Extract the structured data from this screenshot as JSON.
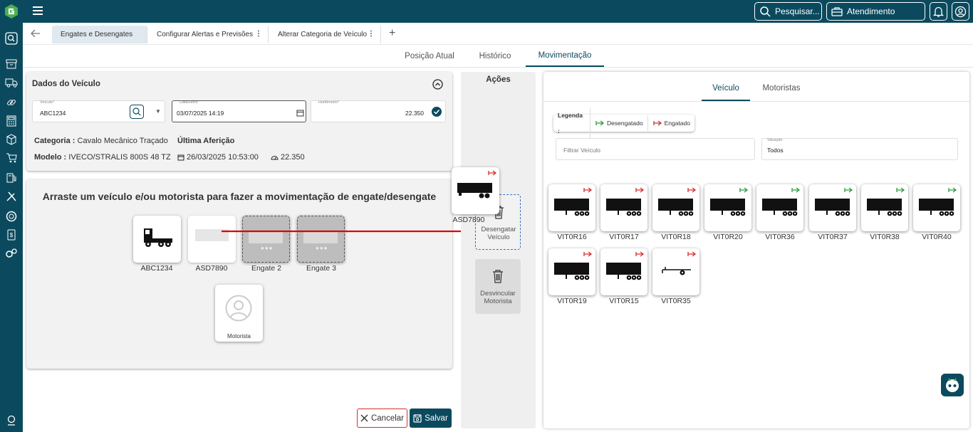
{
  "top": {
    "search_label": "Pesquisar...",
    "service_label": "Atendimento"
  },
  "tabs": [
    {
      "label": "Engates e Desengates"
    },
    {
      "label": "Configurar Alertas e Previsões"
    },
    {
      "label": "Alterar Categoria de Veículo"
    }
  ],
  "subtabs": [
    {
      "label": "Posição Atual"
    },
    {
      "label": "Histórico"
    },
    {
      "label": "Movimentação"
    }
  ],
  "vehicle_card": {
    "title": "Dados do Veículo",
    "vehicle": {
      "label": "Veículo*",
      "value": "ABC1234"
    },
    "datetime": {
      "label": "Data/Hora*",
      "value": "03/07/2025 14:19"
    },
    "odometer": {
      "label": "Hodômetro*",
      "value": "22.350"
    },
    "category_key": "Categoria :",
    "category_value": "Cavalo Mecânico Traçado",
    "last_measure": "Última Aferição",
    "model_key": "Modelo :",
    "model_value": "IVECO/STRALIS 800S 48 TZ",
    "measure_date": "26/03/2025 10:53:00",
    "measure_value": "22.350"
  },
  "drag": {
    "instruction": "Arraste um veículo e/ou motorista para fazer a movimentação de engate/desengate",
    "slots": [
      {
        "label": "ABC1234"
      },
      {
        "label": "ASD7890"
      },
      {
        "label": "Engate 2"
      },
      {
        "label": "Engate 3"
      }
    ],
    "driver_label": "Motorista",
    "dragging_label": "ASD7890"
  },
  "actions": {
    "title": "Ações",
    "uncouple_label": "Desengatar Veículo",
    "unlink_label": "Desvincular Motorista"
  },
  "footer": {
    "cancel_label": "Cancelar",
    "save_label": "Salvar"
  },
  "right": {
    "tabs": [
      {
        "label": "Veículo"
      },
      {
        "label": "Motoristas"
      }
    ],
    "legend_title": "Legenda :",
    "legend_uncoupled": "Desengatado",
    "legend_coupled": "Engatado",
    "filter_placeholder": "Filtrar Veículo",
    "situation_label": "Situação",
    "situation_value": "Todos",
    "vehicles": [
      {
        "label": "VIT0R16",
        "status": "coupled"
      },
      {
        "label": "VIT0R17",
        "status": "coupled"
      },
      {
        "label": "VIT0R18",
        "status": "coupled"
      },
      {
        "label": "VIT0R20",
        "status": "uncoupled"
      },
      {
        "label": "VIT0R36",
        "status": "uncoupled"
      },
      {
        "label": "VIT0R37",
        "status": "uncoupled"
      },
      {
        "label": "VIT0R38",
        "status": "uncoupled"
      },
      {
        "label": "VIT0R40",
        "status": "uncoupled"
      },
      {
        "label": "VIT0R19",
        "status": "coupled"
      },
      {
        "label": "VIT0R15",
        "status": "coupled"
      },
      {
        "label": "VIT0R35",
        "status": "coupled"
      }
    ]
  },
  "colors": {
    "brand": "#0b4a5e",
    "coupled": "#d32f2f",
    "uncoupled": "#2e9b3c",
    "arrow": "#e00000"
  }
}
